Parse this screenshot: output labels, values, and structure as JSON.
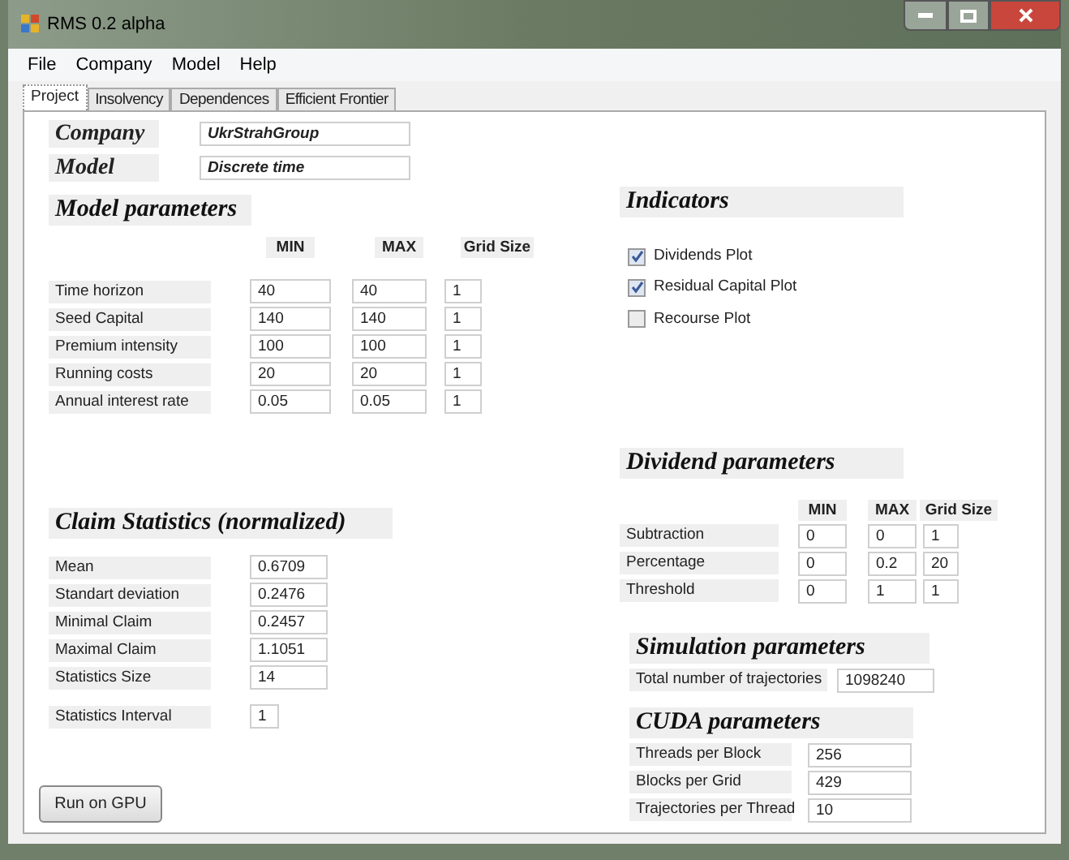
{
  "window": {
    "title": "RMS 0.2 alpha"
  },
  "menu": [
    "File",
    "Company",
    "Model",
    "Help"
  ],
  "tabs": [
    {
      "label": "Project",
      "selected": true
    },
    {
      "label": "Insolvency",
      "selected": false
    },
    {
      "label": "Dependences",
      "selected": false
    },
    {
      "label": "Efficient Frontier",
      "selected": false
    }
  ],
  "company": {
    "label": "Company",
    "value": "UkrStrahGroup"
  },
  "model": {
    "label": "Model",
    "value": "Discrete time"
  },
  "model_parameters": {
    "title": "Model parameters",
    "columns": [
      "MIN",
      "MAX",
      "Grid Size"
    ],
    "rows": [
      {
        "label": "Time horizon",
        "min": "40",
        "max": "40",
        "grid": "1"
      },
      {
        "label": "Seed Capital",
        "min": "140",
        "max": "140",
        "grid": "1"
      },
      {
        "label": "Premium intensity",
        "min": "100",
        "max": "100",
        "grid": "1"
      },
      {
        "label": "Running costs",
        "min": "20",
        "max": "20",
        "grid": "1"
      },
      {
        "label": "Annual interest rate",
        "min": "0.05",
        "max": "0.05",
        "grid": "1"
      }
    ]
  },
  "claim_statistics": {
    "title": "Claim Statistics (normalized)",
    "rows": [
      {
        "label": "Mean",
        "value": "0.6709"
      },
      {
        "label": "Standart deviation",
        "value": "0.2476"
      },
      {
        "label": "Minimal Claim",
        "value": "0.2457"
      },
      {
        "label": "Maximal Claim",
        "value": "1.1051"
      },
      {
        "label": "Statistics Size",
        "value": "14"
      }
    ],
    "interval": {
      "label": "Statistics Interval",
      "value": "1"
    }
  },
  "run_button": "Run on GPU",
  "indicators": {
    "title": "Indicators",
    "items": [
      {
        "label": "Dividends Plot",
        "checked": true
      },
      {
        "label": "Residual Capital Plot",
        "checked": true
      },
      {
        "label": "Recourse Plot",
        "checked": false
      }
    ]
  },
  "dividend_parameters": {
    "title": "Dividend parameters",
    "columns": [
      "MIN",
      "MAX",
      "Grid Size"
    ],
    "rows": [
      {
        "label": "Subtraction",
        "min": "0",
        "max": "0",
        "grid": "1"
      },
      {
        "label": "Percentage",
        "min": "0",
        "max": "0.2",
        "grid": "20"
      },
      {
        "label": "Threshold",
        "min": "0",
        "max": "1",
        "grid": "1"
      }
    ]
  },
  "simulation_parameters": {
    "title": "Simulation parameters",
    "rows": [
      {
        "label": "Total number of trajectories",
        "value": "1098240"
      }
    ]
  },
  "cuda_parameters": {
    "title": "CUDA parameters",
    "rows": [
      {
        "label": "Threads per Block",
        "value": "256"
      },
      {
        "label": "Blocks per Grid",
        "value": "429"
      },
      {
        "label": "Trajectories per Thread",
        "value": "10"
      }
    ]
  }
}
